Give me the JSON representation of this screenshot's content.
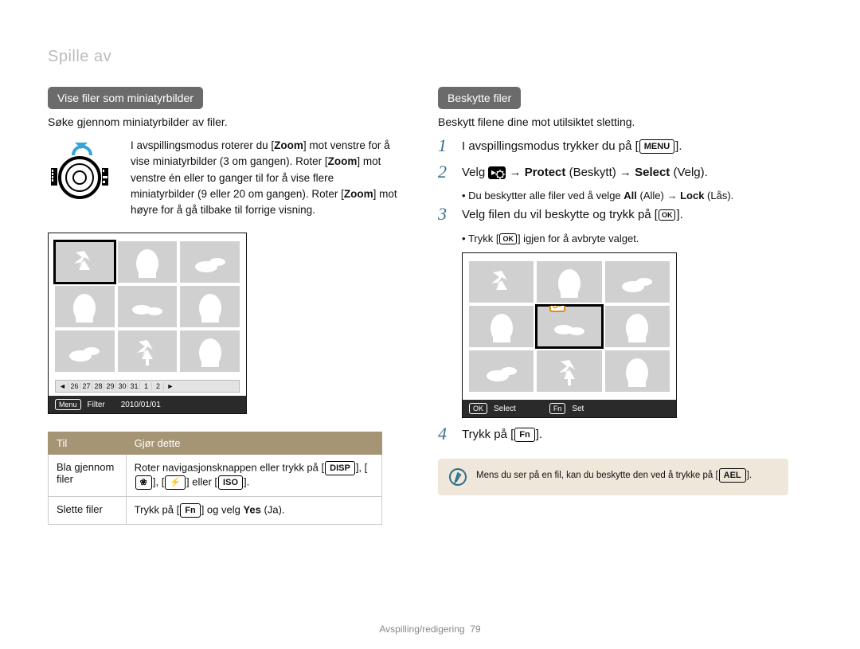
{
  "header": {
    "title": "Spille av"
  },
  "left": {
    "pill": "Vise filer som miniatyrbilder",
    "lead": "Søke gjennom miniatyrbilder av filer.",
    "dial_text_pre": "I avspillingsmodus roterer du [",
    "zoom": "Zoom",
    "dial_text_mid1": "] mot venstre for å vise miniatyrbilder (3 om gangen). Roter [",
    "dial_text_mid2": "] mot venstre én eller to ganger til for å vise flere miniatyrbilder (9 eller 20 om gangen). Roter [",
    "dial_text_end": "] mot høyre for å gå tilbake til forrige visning.",
    "filmstrip": [
      "26",
      "27",
      "28",
      "29",
      "30",
      "31",
      "1",
      "2"
    ],
    "screen_footer": {
      "menu_key": "Menu",
      "filter_label": "Filter",
      "date": "2010/01/01"
    },
    "table": {
      "th1": "Til",
      "th2": "Gjør dette",
      "row1_col1": "Bla gjennom filer",
      "row1_col2_pre": "Roter navigasjonsknappen eller trykk på [",
      "disp": "DISP",
      "iso": "ISO",
      "row1_col2_mid": "], [",
      "row1_col2_eller": "] eller [",
      "row1_col2_end": "].",
      "row2_col1": "Slette filer",
      "row2_col2_pre": "Trykk på [",
      "fn": "Fn",
      "row2_col2_mid": "] og velg ",
      "yes": "Yes",
      "ja": "(Ja)."
    }
  },
  "right": {
    "pill": "Beskytte filer",
    "lead": "Beskytt filene dine mot utilsiktet sletting.",
    "step1_pre": "I avspillingsmodus trykker du på [",
    "menu_key": "MENU",
    "step1_end": "].",
    "step2_pre": "Velg ",
    "protect": "Protect",
    "step2_besk": " (Beskytt) → ",
    "select": "Select",
    "step2_velg": " (Velg).",
    "sub2_pre": "Du beskytter alle filer ved å velge ",
    "all": "All",
    "alle": " (Alle) → ",
    "lock": "Lock",
    "las": " (Lås).",
    "step3_pre": "Velg filen du vil beskytte og trykk på [",
    "ok_key": "OK",
    "step3_end": "].",
    "sub3_pre": "Trykk [",
    "sub3_end": "] igjen for å avbryte valget.",
    "screen_footer": {
      "ok": "OK",
      "select_label": "Select",
      "fn": "Fn",
      "set_label": "Set"
    },
    "step4_pre": "Trykk på [",
    "fn": "Fn",
    "step4_end": "].",
    "note_pre": "Mens du ser på en fil, kan du beskytte den ved å trykke på [",
    "ael": "AEL",
    "note_end": "]."
  },
  "footer": {
    "label": "Avspilling/redigering",
    "page": "79"
  }
}
